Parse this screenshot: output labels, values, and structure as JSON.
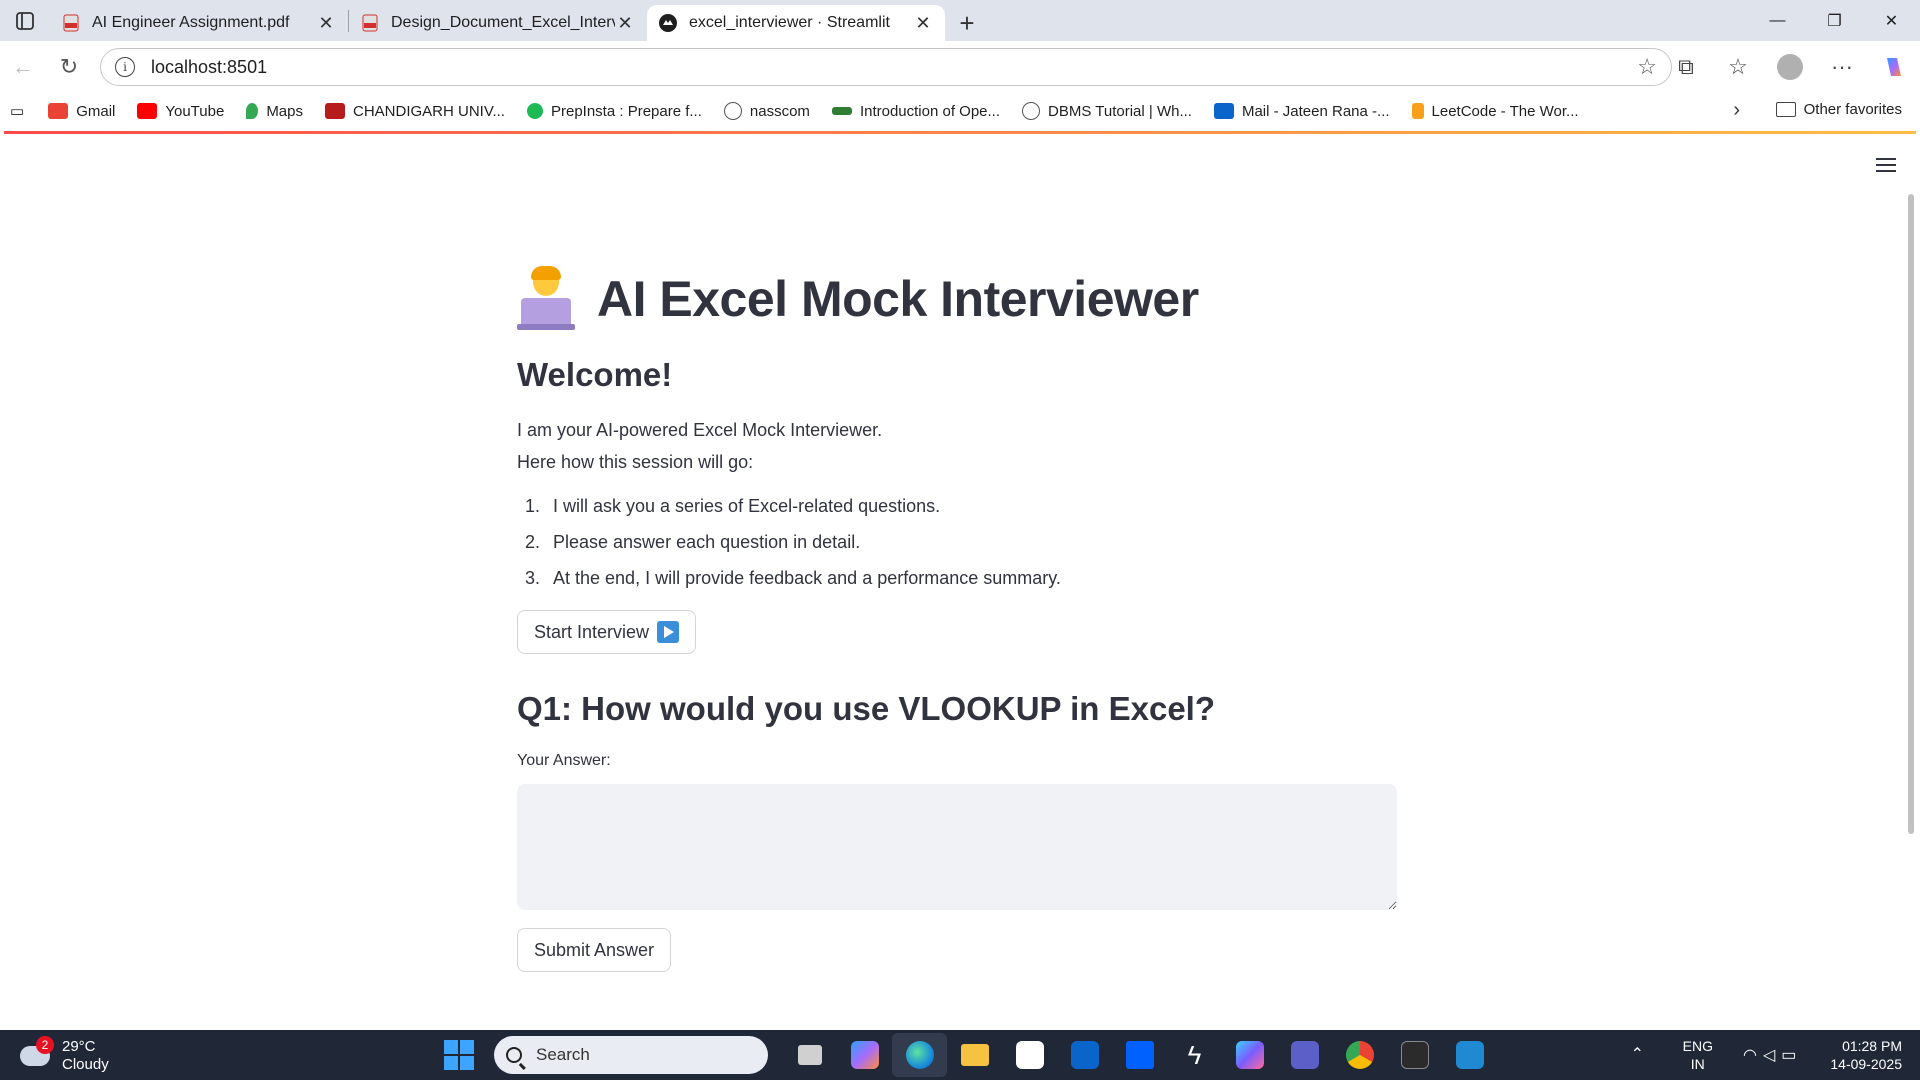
{
  "browser": {
    "tabs": [
      {
        "title": "AI Engineer Assignment.pdf",
        "icon": "pdf-icon",
        "active": false
      },
      {
        "title": "Design_Document_Excel_Interview",
        "icon": "pdf-icon",
        "active": false
      },
      {
        "title": "excel_interviewer · Streamlit",
        "icon": "streamlit-icon",
        "active": true
      }
    ],
    "new_tab_label": "+",
    "close_label": "✕",
    "url": "localhost:8501",
    "bookmarks": [
      {
        "label": "Gmail",
        "color": "#ea4335"
      },
      {
        "label": "YouTube",
        "color": "#ff0000"
      },
      {
        "label": "Maps",
        "color": "#34a853"
      },
      {
        "label": "CHANDIGARH UNIV...",
        "color": "#b71c1c"
      },
      {
        "label": "PrepInsta : Prepare f...",
        "color": "#1db954"
      },
      {
        "label": "nasscom",
        "color": "#555555"
      },
      {
        "label": "Introduction of Ope...",
        "color": "#2e7d32"
      },
      {
        "label": "DBMS Tutorial | Wh...",
        "color": "#555555"
      },
      {
        "label": "Mail - Jateen Rana -...",
        "color": "#0a64c9"
      },
      {
        "label": "LeetCode - The Wor...",
        "color": "#f89f1b"
      }
    ],
    "other_favorites": "Other favorites"
  },
  "app": {
    "title": "AI Excel Mock Interviewer",
    "welcome": "Welcome!",
    "intro_line1": "I am your AI-powered Excel Mock Interviewer.",
    "intro_line2": "Here how this session will go:",
    "steps": [
      {
        "num": "1.",
        "text": "I will ask you a series of Excel-related questions."
      },
      {
        "num": "2.",
        "text": "Please answer each question in detail."
      },
      {
        "num": "3.",
        "text": "At the end, I will provide feedback and a performance summary."
      }
    ],
    "start_button": "Start Interview",
    "question": "Q1: How would you use VLOOKUP in Excel?",
    "answer_label": "Your Answer:",
    "answer_value": "",
    "submit_button": "Submit Answer"
  },
  "taskbar": {
    "weather_badge": "2",
    "temperature": "29°C",
    "condition": "Cloudy",
    "search_placeholder": "Search",
    "lang_line1": "ENG",
    "lang_line2": "IN",
    "time": "01:28 PM",
    "date": "14-09-2025"
  }
}
